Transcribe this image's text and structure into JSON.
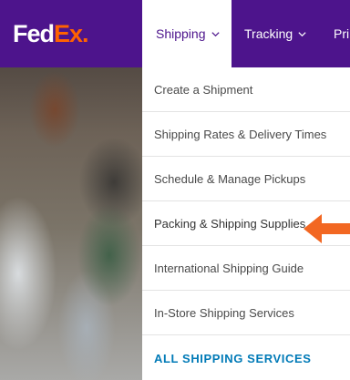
{
  "brand": {
    "logo_part1": "Fed",
    "logo_part2": "Ex",
    "logo_dot": ".",
    "primary_color": "#4d148c",
    "accent_color": "#ff6200",
    "link_color": "#007ab7"
  },
  "nav": {
    "tabs": [
      {
        "label": "Shipping",
        "icon": "chevron-down-icon",
        "active": true
      },
      {
        "label": "Tracking",
        "icon": "chevron-down-icon",
        "active": false
      },
      {
        "label": "Pri",
        "active": false
      }
    ]
  },
  "dropdown": {
    "items": [
      {
        "label": "Create a Shipment"
      },
      {
        "label": "Shipping Rates & Delivery Times"
      },
      {
        "label": "Schedule & Manage Pickups"
      },
      {
        "label": "Packing & Shipping Supplies"
      },
      {
        "label": "International Shipping Guide"
      },
      {
        "label": "In-Store Shipping Services"
      }
    ],
    "all_label": "ALL SHIPPING SERVICES"
  },
  "annotation": {
    "icon": "arrow-left-icon",
    "color": "#f26722"
  }
}
